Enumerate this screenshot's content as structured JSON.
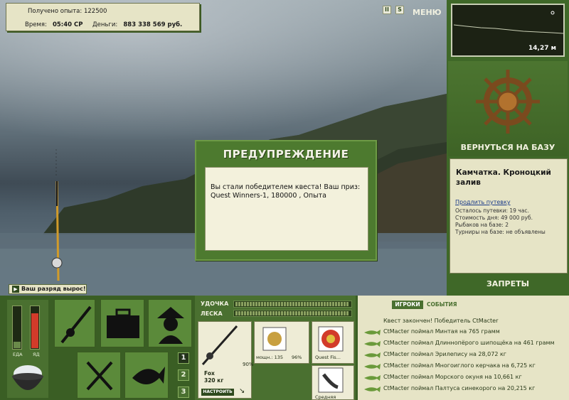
{
  "hud": {
    "exp_label": "Получено опыта:",
    "exp_value": "122500",
    "time_label": "Время:",
    "time_value": "05:40 СР",
    "money_label": "Деньги:",
    "money_value": "883 338 569 руб."
  },
  "top_icons": {
    "pause": "II",
    "sound": "S",
    "menu": "МЕНЮ"
  },
  "rank_notice": "Ваш разряд вырос!",
  "depth": {
    "value": "14,27 м"
  },
  "location": {
    "base_button": "ВЕРНУТЬСЯ НА БАЗУ",
    "title": "Камчатка. Кроноцкий залив",
    "extend_link": "Продлить путевку",
    "lines": [
      "Осталось путевки: 19 час.",
      "Стоимость дня: 49 000 руб.",
      "Рыбаков на базе: 2",
      "Турниры на базе: не объявлены"
    ],
    "bans_button": "ЗАПРЕТЫ"
  },
  "dialog": {
    "title": "ПРЕДУПРЕЖДЕНИЕ",
    "message": "Вы стали победителем квеста! Ваш приз: Quest Winners-1, 180000 , Опыта"
  },
  "status": {
    "food_label": "ЕДА",
    "poison_label": "ЯД",
    "food_level": 0.15,
    "poison_level": 0.85
  },
  "page_numbers": [
    "1",
    "2",
    "3"
  ],
  "gear": {
    "rod_label": "УДОЧКА",
    "line_label": "ЛЕСКА",
    "rod_name": "Fox",
    "rod_weight": "320 кг",
    "rod_pct": "90%",
    "setup_button": "НАСТРОИТЬ",
    "reel_power": "мощн.: 135",
    "reel_pct": "96%",
    "line_name": "Quest Fis...",
    "lure_name": "Средняя"
  },
  "feed": {
    "tab_players": "ИГРОКИ",
    "tab_events": "СОБЫТИЯ",
    "header": "Квест закончен! Победитель CtMacter",
    "rows": [
      "CtMacter поймал Минтая на 765 грамм",
      "CtMacter поймал Длиннопёрого шипощёка на 461 грамм",
      "CtMacter поймал Эрилепису на 28,072 кг",
      "CtMacter поймал Многоиглого керчака на 6,725 кг",
      "CtMacter поймал Морского окуня на 10,661 кг",
      "CtMacter поймал Палтуса синекорого на 20,215 кг"
    ]
  },
  "colors": {
    "panel_green": "#3f6828",
    "cream": "#e6e4c6",
    "dialog_green": "#4d7a2f"
  }
}
